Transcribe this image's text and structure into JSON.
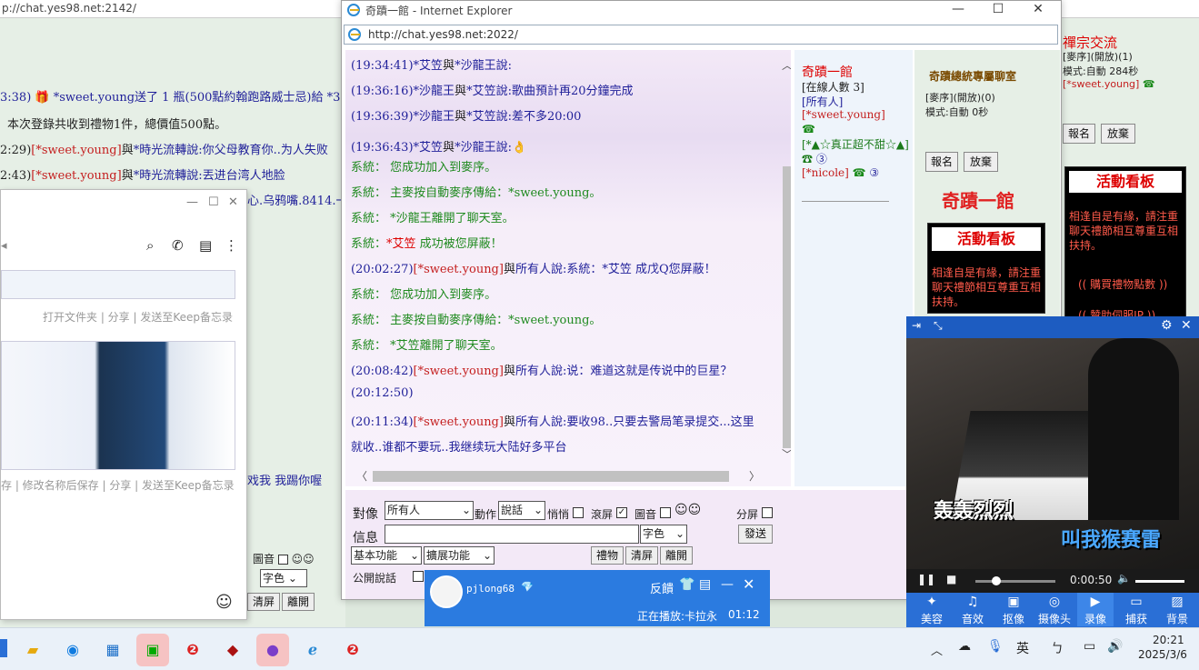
{
  "background_window": {
    "url": "p://chat.yes98.net:2142/",
    "lines": [
      {
        "time": "3:38)",
        "text": "*sweet.young送了 1 瓶(500點約翰跑路威士忌)給 *3"
      },
      {
        "time": "",
        "text": "本次登錄共收到禮物1件，總價值500點。"
      },
      {
        "time": "2:29)",
        "user": "[*sweet.young]",
        "mid": "與",
        "target": "*時光流轉",
        "say": "說:",
        "msg": "你父母教育你..为人失败"
      },
      {
        "time": "2:43)",
        "user": "[*sweet.young]",
        "mid": "與",
        "target": "*時光流轉",
        "say": "說:",
        "msg": "丟进台湾人地脸"
      },
      {
        "time": "",
        "text": "心.乌鸦嘴.8414.一"
      },
      {
        "time": "",
        "text": "戏我 我踢你喔"
      }
    ],
    "bottom_controls": {
      "sound_label": "圖音",
      "emoji": "☺☺",
      "font_color": "字色",
      "clear_label": "清屏",
      "leave_label": "離開"
    },
    "right_panel": {
      "title": "禪宗交流",
      "order_status": "[麥序](開放)(1)",
      "mode": "模式:自動 284秒",
      "user": "[*sweet.young]",
      "signup": "報名",
      "giveup": "放棄",
      "board_title": "活動看板",
      "board_text": "相逢自是有緣，請注重聊天禮節相互尊重互相扶持。",
      "board_link": "(( 購買禮物點數 ))",
      "board_link2": "(( 贊助伺服IP ))"
    }
  },
  "phone_window": {
    "row1_caption": "打开文件夹 | 分享 | 发送至Keep备忘录",
    "row2_caption": "存 | 修改名称后保存 | 分享 | 发送至Keep备忘录"
  },
  "ie_window": {
    "title": "奇蹟一館 - Internet Explorer",
    "address": "http://chat.yes98.net:2022/",
    "messages": [
      {
        "time": "(19:34:41)",
        "from": "*艾笠",
        "mid": "與",
        "to": "*沙龍王",
        "say": "說:",
        "msg": "",
        "type": "chat"
      },
      {
        "time": "(19:36:16)",
        "from": "*沙龍王",
        "mid": "與",
        "to": "*艾笠",
        "say": "說:",
        "msg": "歌曲預計再20分鐘完成",
        "type": "chat"
      },
      {
        "time": "(19:36:39)",
        "from": "*沙龍王",
        "mid": "與",
        "to": "*艾笠",
        "say": "說:",
        "msg": "差不多20:00",
        "type": "chat"
      },
      {
        "time": "(19:36:43)",
        "from": "*艾笠",
        "mid": "與",
        "to": "*沙龍王",
        "say": "說:",
        "msg": "👌",
        "type": "chat"
      },
      {
        "label": "系統：",
        "msg": "您成功加入到麥序。",
        "type": "sys"
      },
      {
        "label": "系統：",
        "msg": "主麥按自動麥序傳給：*sweet.young。",
        "type": "sys"
      },
      {
        "label": "系統：",
        "msg": "*沙龍王離開了聊天室。",
        "type": "sys"
      },
      {
        "label": "系統：",
        "user": "*艾笠",
        "msg": "成功被您屏蔽！",
        "type": "sysblock"
      },
      {
        "time": "(20:02:27)",
        "from": "[*sweet.young]",
        "mid": "與",
        "to": "所有人",
        "say": "說:",
        "msg": "系統：*艾笠 成戊Q您屏蔽！",
        "type": "chat2"
      },
      {
        "label": "系統：",
        "msg": "您成功加入到麥序。",
        "type": "sys"
      },
      {
        "label": "系統：",
        "msg": "主麥按自動麥序傳給：*sweet.young。",
        "type": "sys"
      },
      {
        "label": "系統：",
        "msg": "*艾笠離開了聊天室。",
        "type": "sys"
      },
      {
        "time": "(20:08:42)",
        "from": "[*sweet.young]",
        "mid": "與",
        "to": "所有人",
        "say": "說:",
        "msg": "说：难道这就是传说中的巨星？",
        "type": "chat2"
      },
      {
        "time": "(20:12:50)",
        "type": "time"
      },
      {
        "time": "(20:11:34)",
        "from": "[*sweet.young]",
        "mid": "與",
        "to": "所有人",
        "say": "說:",
        "msg": "要收98..只要去警局笔录提交...这里",
        "type": "chat2"
      },
      {
        "text": "就收..谁都不要玩..我继续玩大陆好多平台",
        "type": "cont"
      }
    ],
    "users_panel": {
      "room": "奇蹟一館",
      "online": "[在線人數 3]",
      "all": "[所有人]",
      "u1": "[*sweet.young]",
      "u2": "[*▲☆真正超不甜☆▲]",
      "u3": "[*nicole]"
    },
    "side": {
      "banner": "奇蹟總統專屬聊室",
      "order_status": "[麥序](開放)(0)",
      "mode": "模式:自動 0秒",
      "signup": "報名",
      "giveup": "放棄",
      "logo": "奇蹟一館",
      "board_title": "活動看板",
      "board_text": "相逢自是有緣，請注重聊天禮節相互尊重互相扶持。"
    },
    "input": {
      "to_label": "對像",
      "to_value": "所有人",
      "action_label": "動作",
      "action_value": "說話",
      "whisper": "悄悄",
      "scroll": "滾屏",
      "sound": "圖音",
      "emoji": "☺☺",
      "split": "分屏",
      "message_label": "信息",
      "font_color": "字色",
      "send": "發送",
      "basic": "基本功能",
      "extended": "擴展功能",
      "gift": "禮物",
      "clear": "清屏",
      "leave": "離開",
      "public_label": "公開說話"
    }
  },
  "player": {
    "lyric_left": "轰轰烈烈",
    "lyric_right": "叫我猴赛雷",
    "time": "0:00:50",
    "tools": [
      "美容",
      "音效",
      "抠像",
      "摄像头",
      "录像",
      "捕获",
      "背景"
    ]
  },
  "music_bar": {
    "user": "pjlong68",
    "feedback": "反饋",
    "now_playing": "正在播放:卡拉永",
    "time": "01:12"
  },
  "taskbar": {
    "ime": "英",
    "time": "20:21",
    "date": "2025/3/6"
  },
  "colors": {
    "system_green": "#1f8a1f",
    "user_red": "#c41e1e",
    "name_blue": "#1f1f99",
    "accent_blue": "#2a6fd6"
  }
}
